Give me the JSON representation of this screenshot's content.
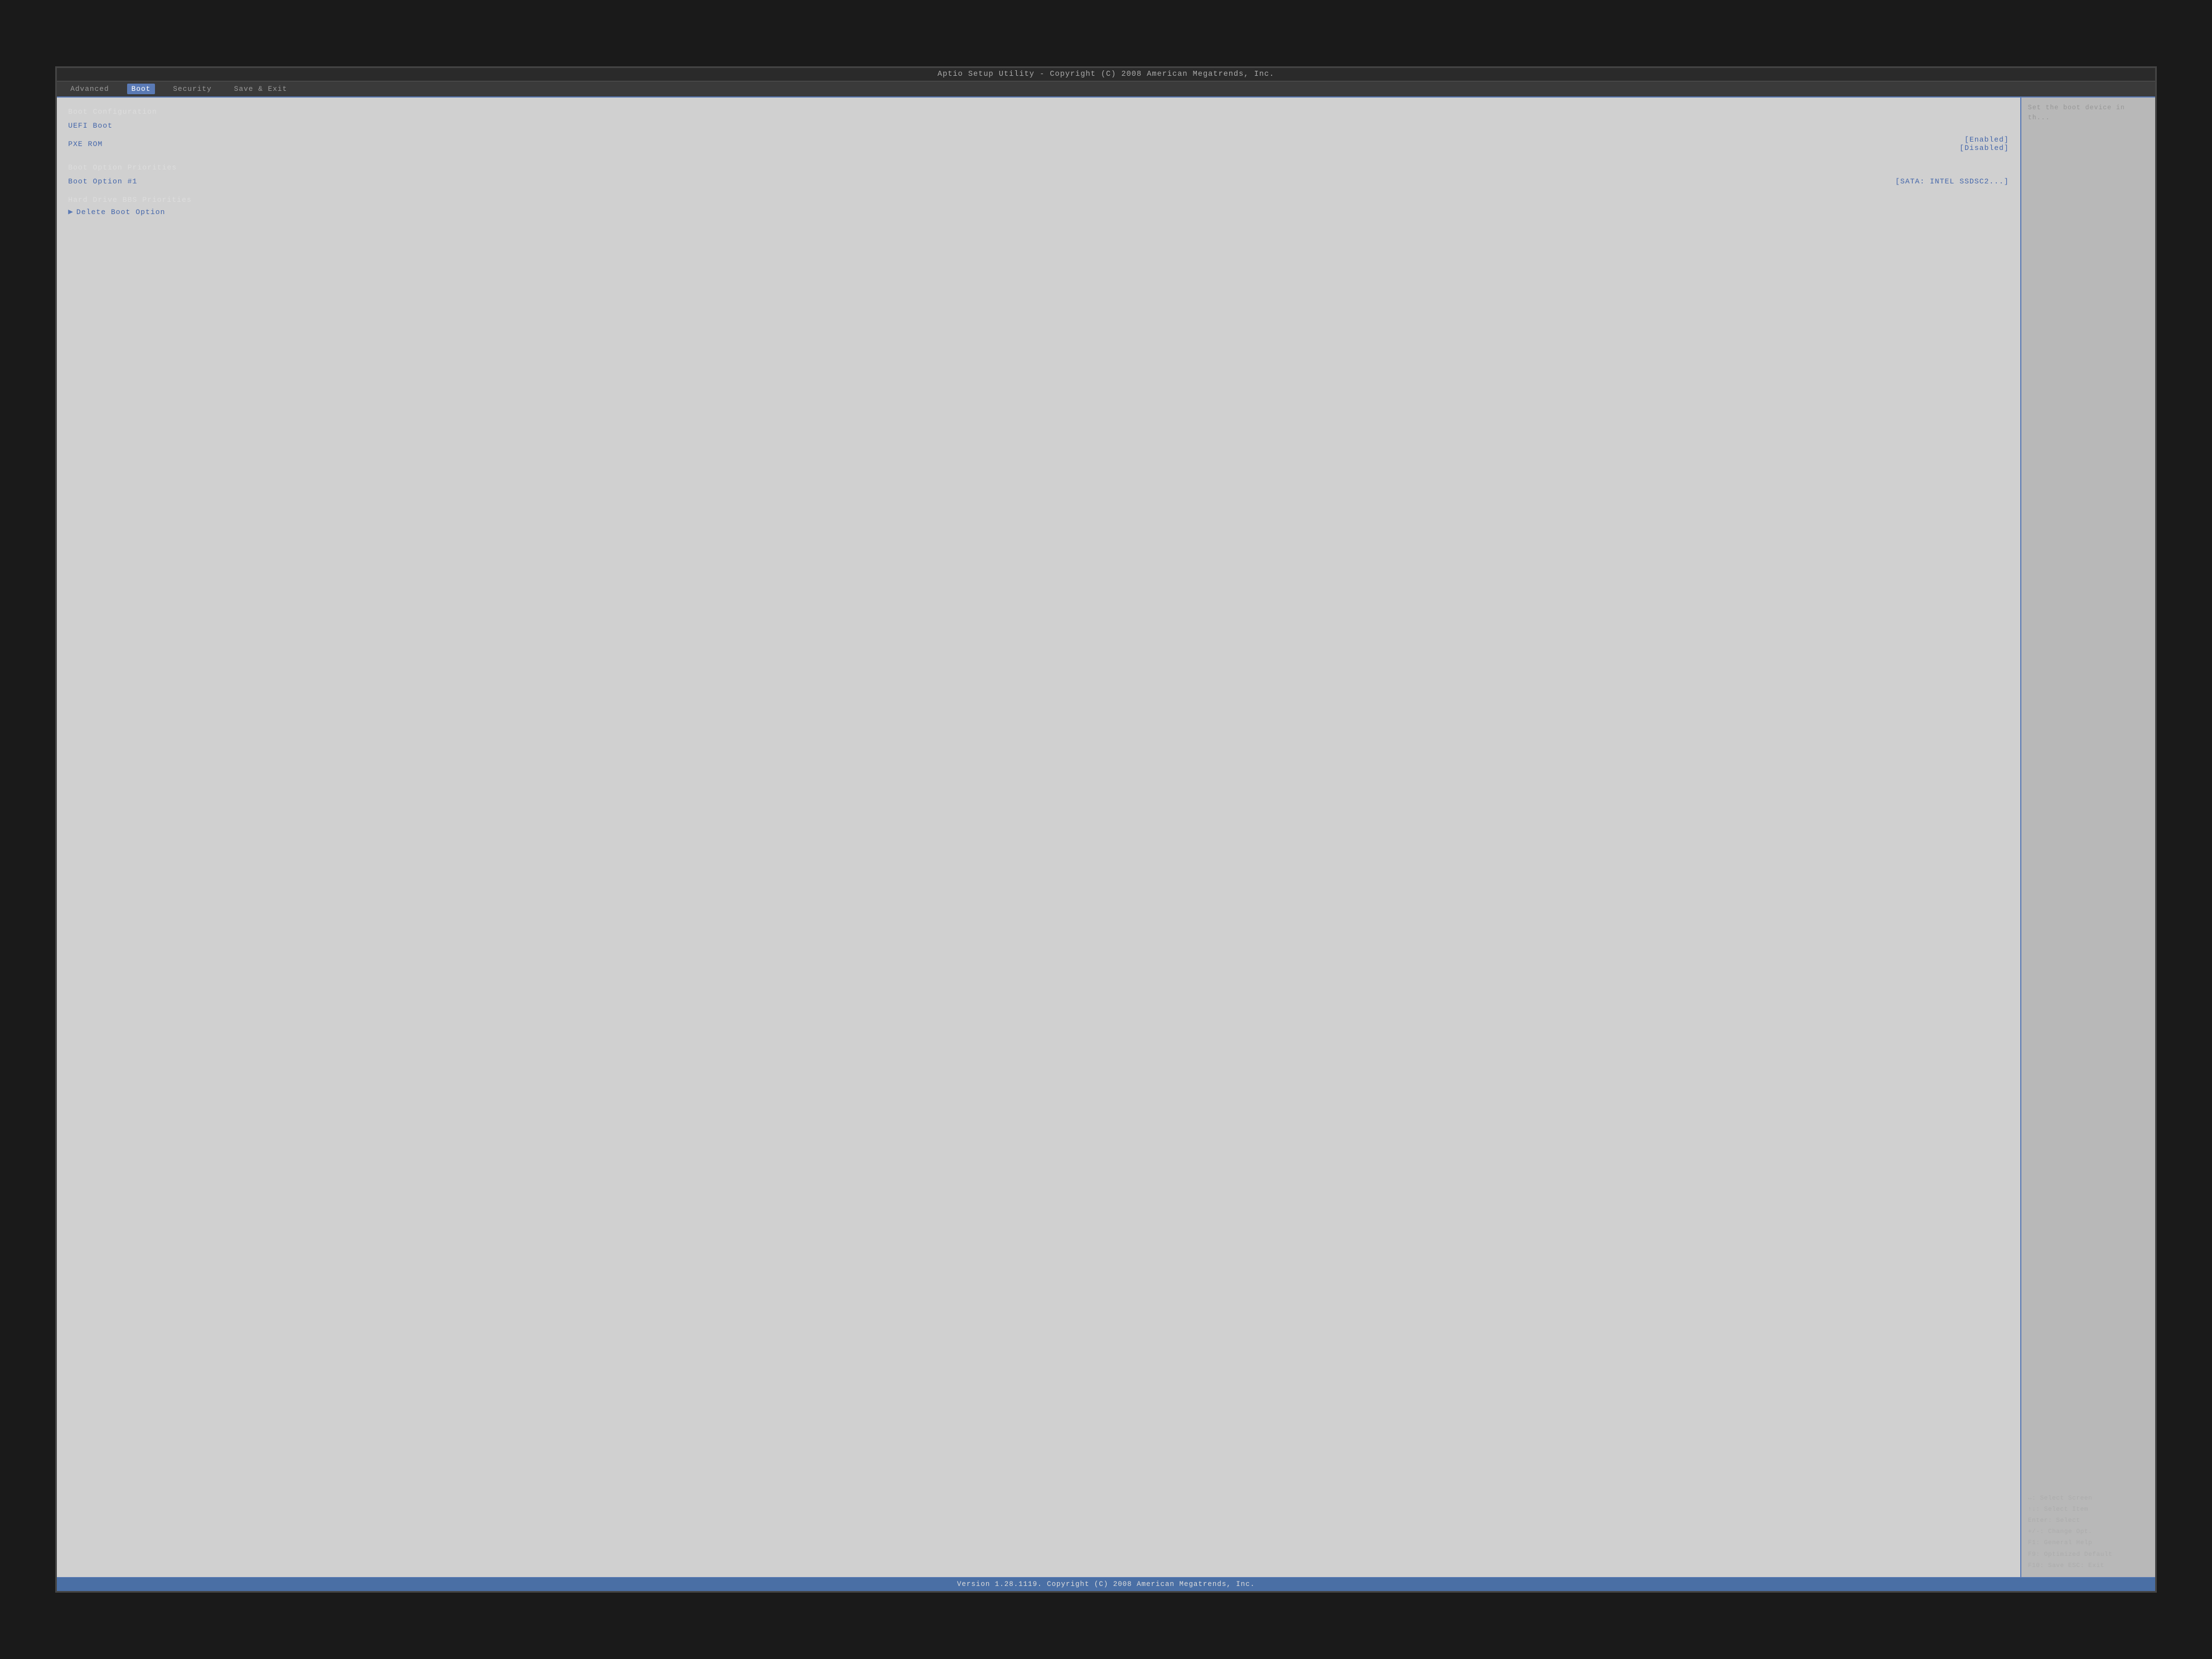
{
  "title_bar": {
    "text": "Aptio Setup Utility - Copyright (C) 2008 American Megatrends, Inc."
  },
  "nav": {
    "items": [
      {
        "label": "Advanced",
        "active": false
      },
      {
        "label": "Boot",
        "active": true
      },
      {
        "label": "Security",
        "active": false
      },
      {
        "label": "Save & Exit",
        "active": false
      }
    ]
  },
  "settings": {
    "section1": {
      "label": "Boot Configuration"
    },
    "uefi_boot": {
      "label": "UEFI Boot"
    },
    "pxe_rom": {
      "label": "PXE ROM",
      "value1": "[Enabled]",
      "value2": "[Disabled]"
    },
    "section2": {
      "label": "Boot Option Priorities"
    },
    "boot_option1": {
      "label": "Boot Option #1",
      "value": "[SATA: INTEL SSDSC2...]"
    },
    "section3": {
      "label": "Hard Drive BBS Priorities"
    },
    "delete_boot": {
      "label": "Delete Boot Option"
    }
  },
  "help": {
    "top_text": "Set the boot\ndevice in th...",
    "keys": [
      "↔: Select Screen",
      "↑↓: Select Item",
      "Enter: Select",
      "+/-: Change Opt.",
      "F1: General Help",
      "F9: Optimized Default",
      "F10: Save  ESC: Exit"
    ]
  },
  "status_bar": {
    "text": "Version 1.28.1119. Copyright (C) 2008 American Megatrends, Inc."
  }
}
